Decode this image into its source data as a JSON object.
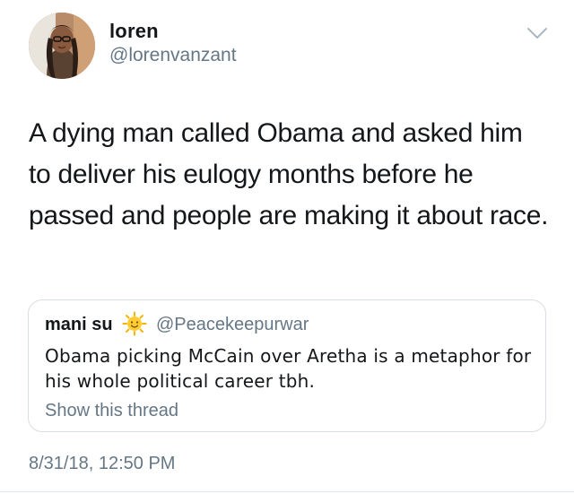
{
  "tweet": {
    "author": {
      "display_name": "loren",
      "handle": "@lorenvanzant"
    },
    "text": "A dying man called Obama and asked him to deliver his eulogy months before he passed and people are making it about race.",
    "timestamp": "8/31/18, 12:50 PM",
    "menu_icon": "chevron-down-icon"
  },
  "quote": {
    "author": {
      "display_name": "mani su",
      "emoji": "sun-emoji",
      "handle": "@Peacekeepurwar"
    },
    "text": "Obama picking McCain over Aretha is a metaphor for his whole political career tbh.",
    "show_thread_label": "Show this thread"
  },
  "colors": {
    "primary_text": "#14171a",
    "secondary_text": "#657786",
    "border": "#d8dee3"
  }
}
